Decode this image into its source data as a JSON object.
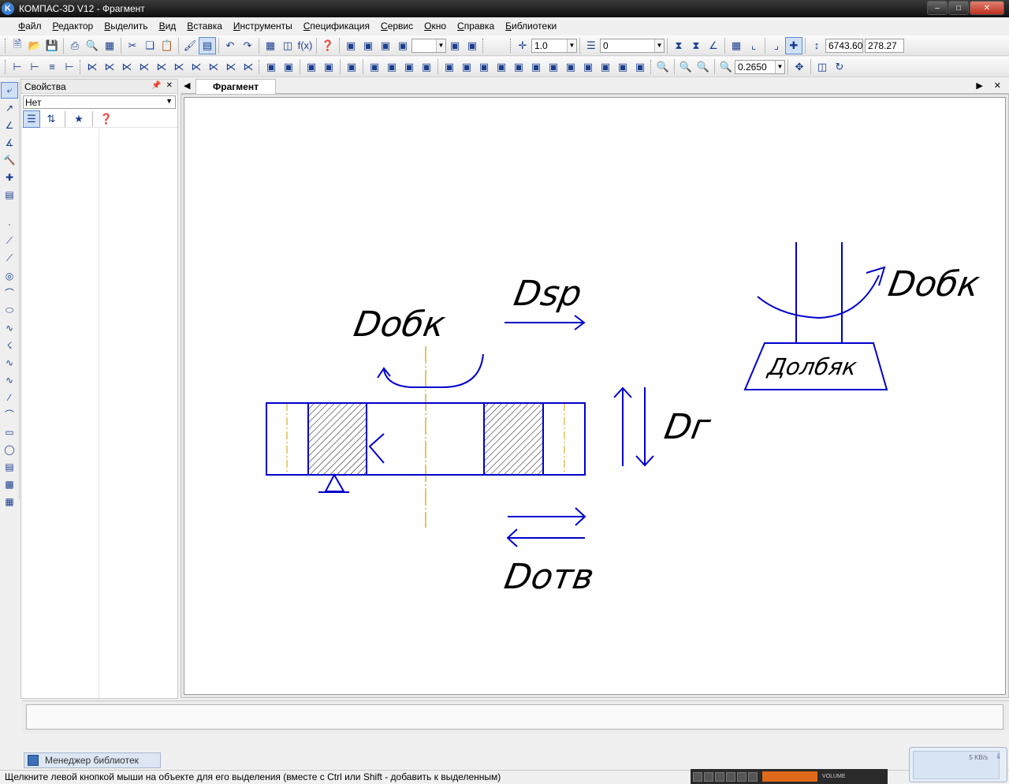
{
  "window": {
    "title": "КОМПАС-3D V12 - Фрагмент",
    "icon": "kompas-logo-icon"
  },
  "menu": [
    "Файл",
    "Редактор",
    "Выделить",
    "Вид",
    "Вставка",
    "Инструменты",
    "Спецификация",
    "Сервис",
    "Окно",
    "Справка",
    "Библиотеки"
  ],
  "toolbar1": {
    "step_value": "1.0",
    "layer_value": "0",
    "coord_x": "6743.60",
    "coord_y": "278.27"
  },
  "toolbar2": {
    "zoom_value": "0.2650"
  },
  "properties_panel": {
    "title": "Свойства",
    "selector_value": "Нет"
  },
  "document": {
    "tab_label": "Фрагмент"
  },
  "drawing": {
    "labels": {
      "dobk_left": "Dобк",
      "dsp": "Dsp",
      "dg": "Dг",
      "dotv": "Dотв",
      "dobk_right": "Dобк",
      "tool": "Долбяк"
    },
    "colors": {
      "geometry": "#0000cc",
      "axis": "#c8a000",
      "text": "#000000"
    }
  },
  "library_tab": {
    "label": "Менеджер библиотек"
  },
  "status": {
    "text": "Щелкните левой кнопкой мыши на объекте для его выделения (вместе с Ctrl или Shift - добавить к выделенным)"
  },
  "net_widget": {
    "speed": "5 KB/s"
  },
  "media_widget": {
    "volume_label": "VOLUME"
  }
}
